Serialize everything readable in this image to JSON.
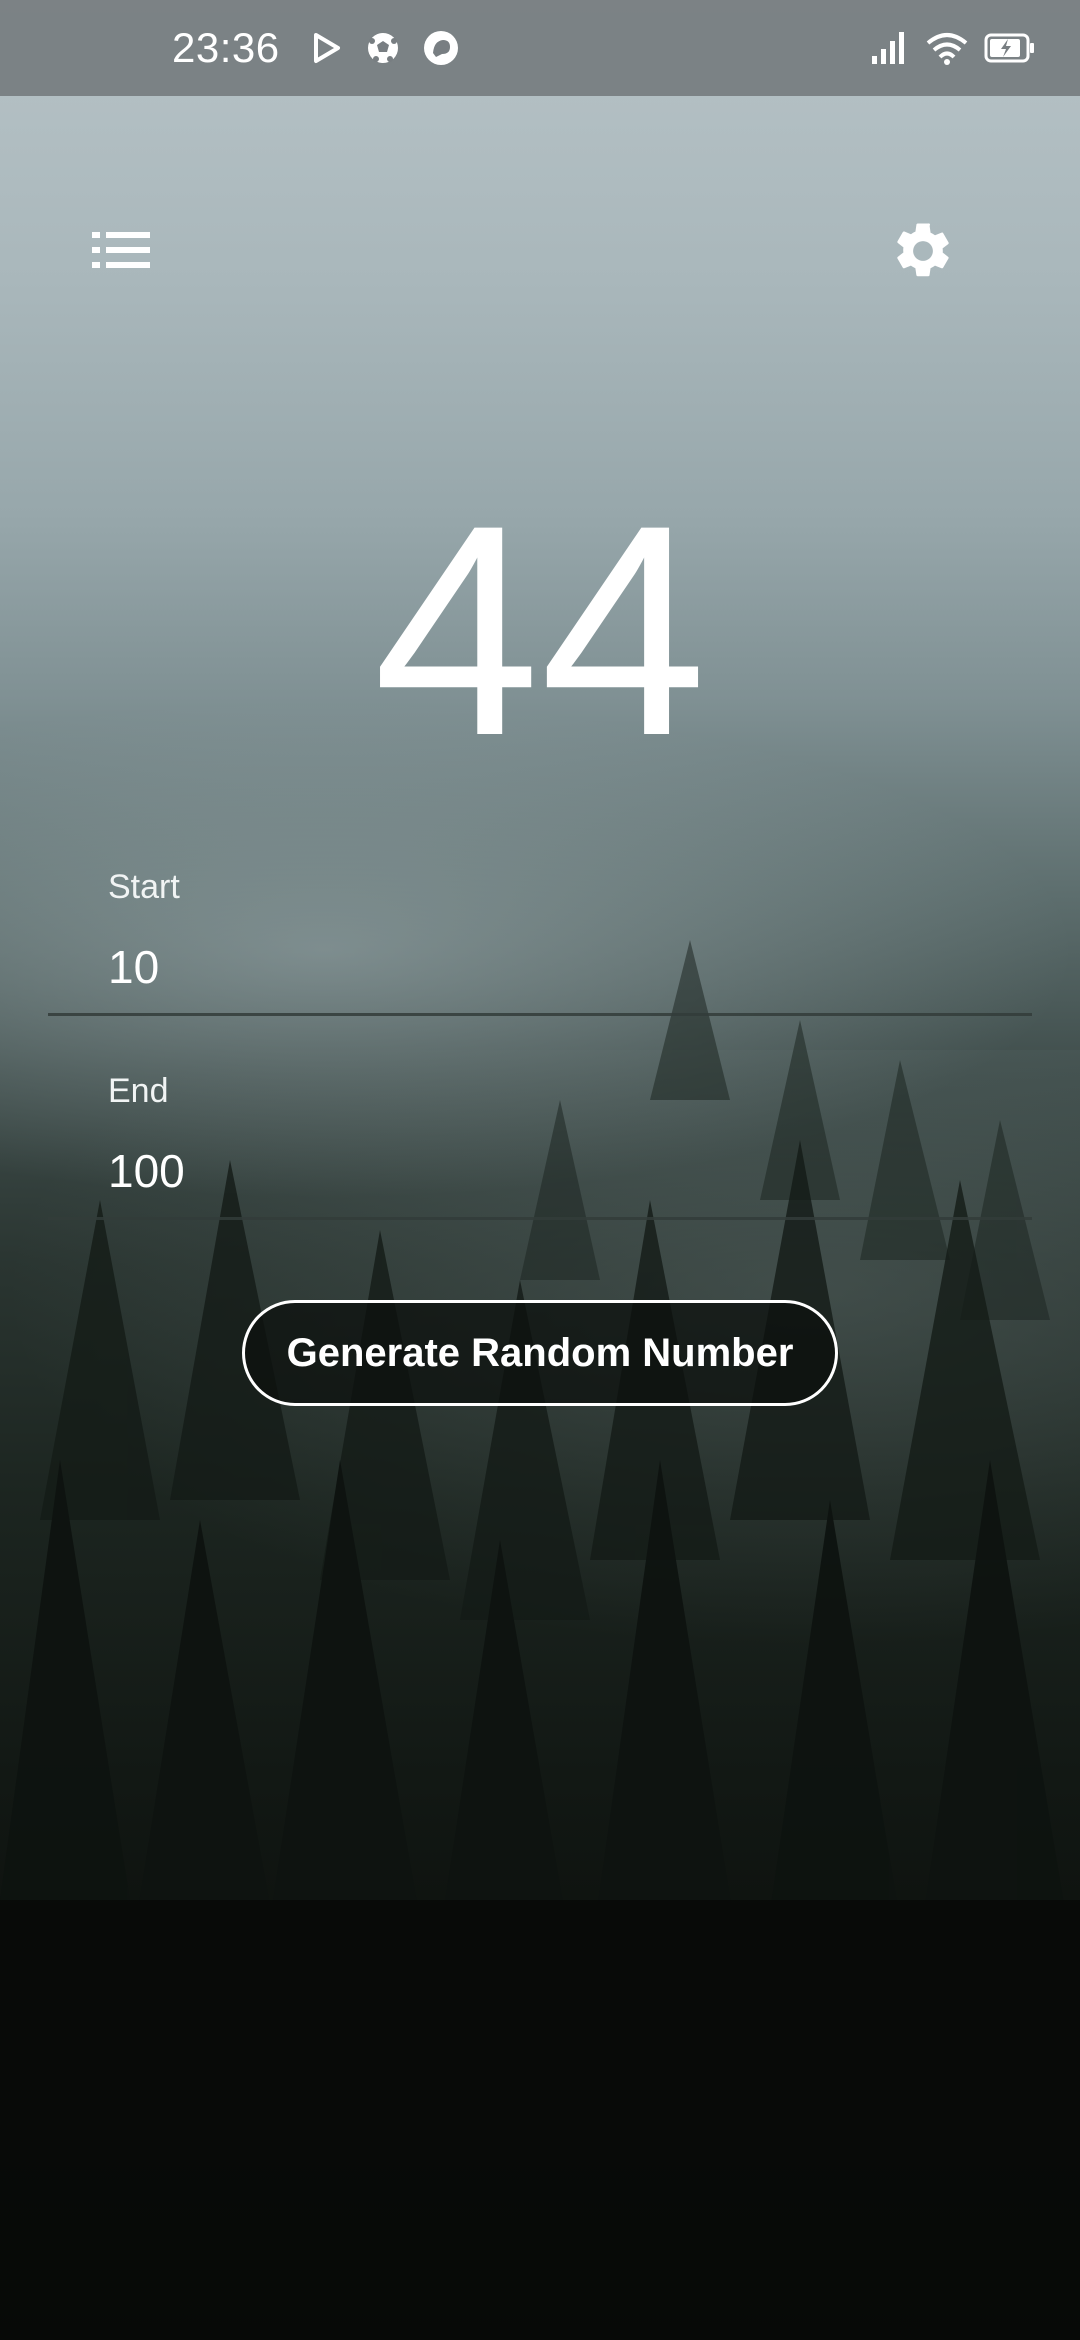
{
  "status_bar": {
    "time": "23:36",
    "left_icons": [
      "play-store-icon",
      "soccer-ball-icon",
      "chat-bubble-icon"
    ],
    "right_icons": [
      "signal-icon",
      "wifi-icon",
      "battery-charging-icon"
    ]
  },
  "app_bar": {
    "menu_icon": "list-icon",
    "settings_icon": "gear-icon"
  },
  "result": {
    "value": "44"
  },
  "start_field": {
    "label": "Start",
    "value": "10"
  },
  "end_field": {
    "label": "End",
    "value": "100"
  },
  "generate_button": {
    "label": "Generate Random Number"
  },
  "colors": {
    "status_bar": "#787e82",
    "text": "#ffffff",
    "button_border": "#ffffff"
  }
}
